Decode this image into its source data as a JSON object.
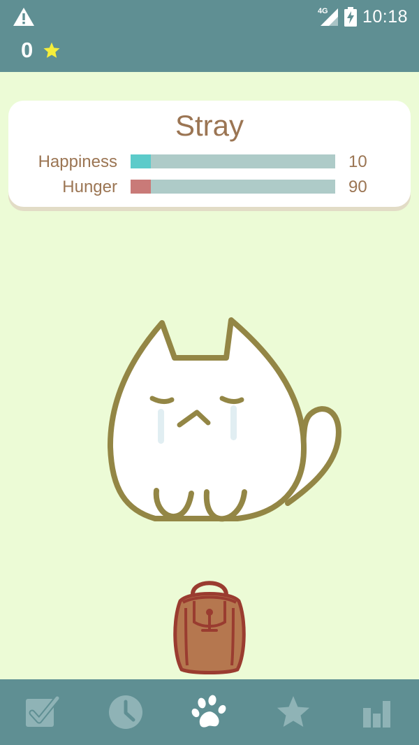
{
  "status_bar": {
    "network": "4G",
    "time": "10:18"
  },
  "header": {
    "score": "0"
  },
  "pet": {
    "name": "Stray",
    "stats": [
      {
        "label": "Happiness",
        "value": "10",
        "level": 0.1,
        "color": "#5ccbca"
      },
      {
        "label": "Hunger",
        "value": "90",
        "level": 0.1,
        "color": "#c97a78"
      }
    ]
  },
  "bottom_nav": {
    "items": [
      {
        "icon": "checkbox-icon",
        "active": false
      },
      {
        "icon": "clock-icon",
        "active": false
      },
      {
        "icon": "paw-icon",
        "active": true
      },
      {
        "icon": "star-icon",
        "active": false
      },
      {
        "icon": "bar-chart-icon",
        "active": false
      }
    ],
    "active_color": "#ffffff",
    "inactive_color": "#8fb3b6"
  },
  "colors": {
    "header_bg": "#5f8f93",
    "background": "#ecfbd6",
    "text_brown": "#9b7553",
    "bar_track": "#aecbc8"
  }
}
